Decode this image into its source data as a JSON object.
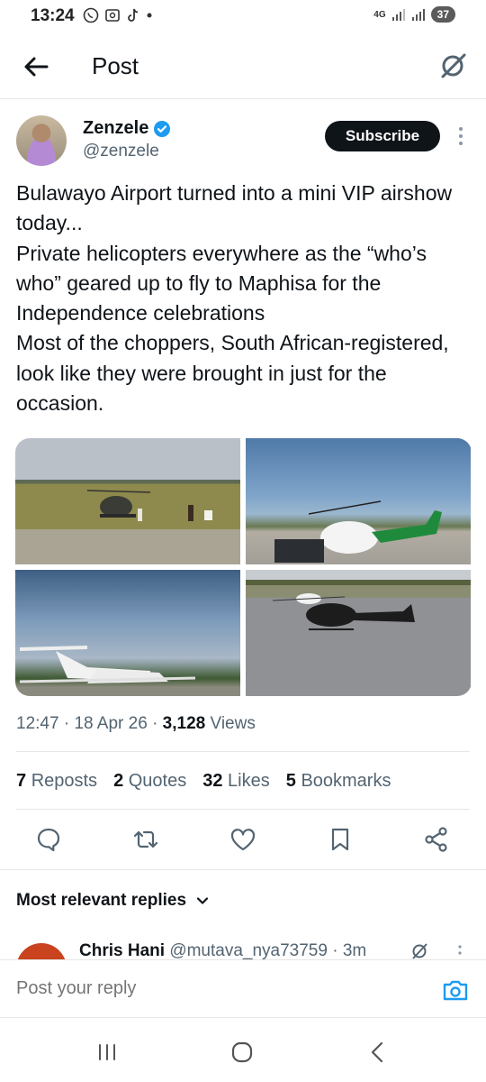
{
  "status_bar": {
    "time": "13:24",
    "network": "4G",
    "battery": "37"
  },
  "header": {
    "title": "Post"
  },
  "author": {
    "name": "Zenzele",
    "handle": "@zenzele",
    "verified_color": "#1d9bf0"
  },
  "subscribe_label": "Subscribe",
  "tweet": {
    "text": "Bulawayo Airport turned into a mini VIP airshow today...\nPrivate helicopters everywhere as the “who’s who” geared up to fly to Maphisa for the Independence celebrations\nMost of the choppers, South African-registered, look like they were brought in just for the occasion."
  },
  "meta": {
    "time": "12:47",
    "date": "18 Apr 26",
    "views_count": "3,128",
    "views_label": "Views"
  },
  "stats": [
    {
      "count": "7",
      "label": "Reposts"
    },
    {
      "count": "2",
      "label": "Quotes"
    },
    {
      "count": "32",
      "label": "Likes"
    },
    {
      "count": "5",
      "label": "Bookmarks"
    }
  ],
  "replies_section": {
    "title": "Most relevant replies"
  },
  "reply_preview": {
    "name": "Chris Hani",
    "handle": "@mutava_nya73759",
    "time": "3m"
  },
  "reply_bar": {
    "placeholder": "Post your reply"
  },
  "icons": {
    "back": "arrow-left-icon",
    "grok": "grok-icon",
    "reply": "comment-icon",
    "repost": "repost-icon",
    "like": "heart-icon",
    "bookmark": "bookmark-icon",
    "share": "share-icon",
    "camera": "camera-icon"
  },
  "colors": {
    "text": "#0f1419",
    "secondary": "#536471",
    "accent": "#1d9bf0"
  }
}
